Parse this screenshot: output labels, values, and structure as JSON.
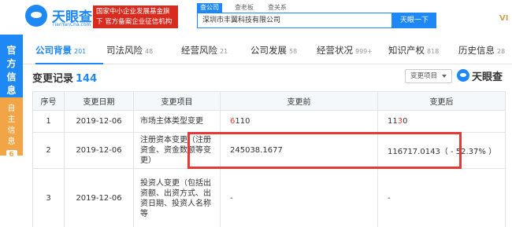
{
  "brand": {
    "name": "天眼查",
    "domain": "TianYanCha.com",
    "promo": "国家中小企业发展基金旗下 官方备案企业征信机构"
  },
  "search": {
    "tabs": [
      "查公司",
      "查老板",
      "查关系"
    ],
    "value": "深圳市丰翼科技有限公司",
    "button": "天眼一下"
  },
  "vip_label": "VI",
  "side": {
    "official": "官方信息",
    "self": "自主信息",
    "self_count": "6"
  },
  "nav": [
    {
      "label": "公司背景",
      "count": "201"
    },
    {
      "label": "司法风险",
      "count": "48"
    },
    {
      "label": "经营风险",
      "count": "21"
    },
    {
      "label": "公司发展",
      "count": "58"
    },
    {
      "label": "经营状况",
      "count": "999+"
    },
    {
      "label": "知识产权",
      "count": "818"
    },
    {
      "label": "历史信息",
      "count": "28"
    }
  ],
  "section": {
    "title": "变更记录",
    "count": "144",
    "filter": "变更项目",
    "watermark": "天眼查"
  },
  "table": {
    "headers": [
      "序号",
      "变更日期",
      "变更项目",
      "变更前",
      "变更后"
    ],
    "rows": [
      {
        "idx": "1",
        "date": "2019-12-06",
        "item": "市场主体类型变更",
        "before_mark": "6",
        "before_rest": "110",
        "after_lead": "11",
        "after_mark": "3",
        "after_tail": "0"
      },
      {
        "idx": "2",
        "date": "2019-12-06",
        "item": "注册资本变更（注册资金、资金数额等变更）",
        "before": "245038.1677",
        "after": "116717.0143（ - 52.37% ）"
      },
      {
        "idx": "3",
        "date": "2019-12-06",
        "item": "投资人变更（包括出资额、出资方式、出资日期、投资人名称等",
        "before": "-",
        "after": "-"
      }
    ]
  },
  "colors": {
    "brand_blue": "#1e88f5",
    "promo_red": "#d72b1f",
    "highlight_red": "#e53935",
    "increase_green": "#2fae4d",
    "self_orange": "#f1a546"
  }
}
